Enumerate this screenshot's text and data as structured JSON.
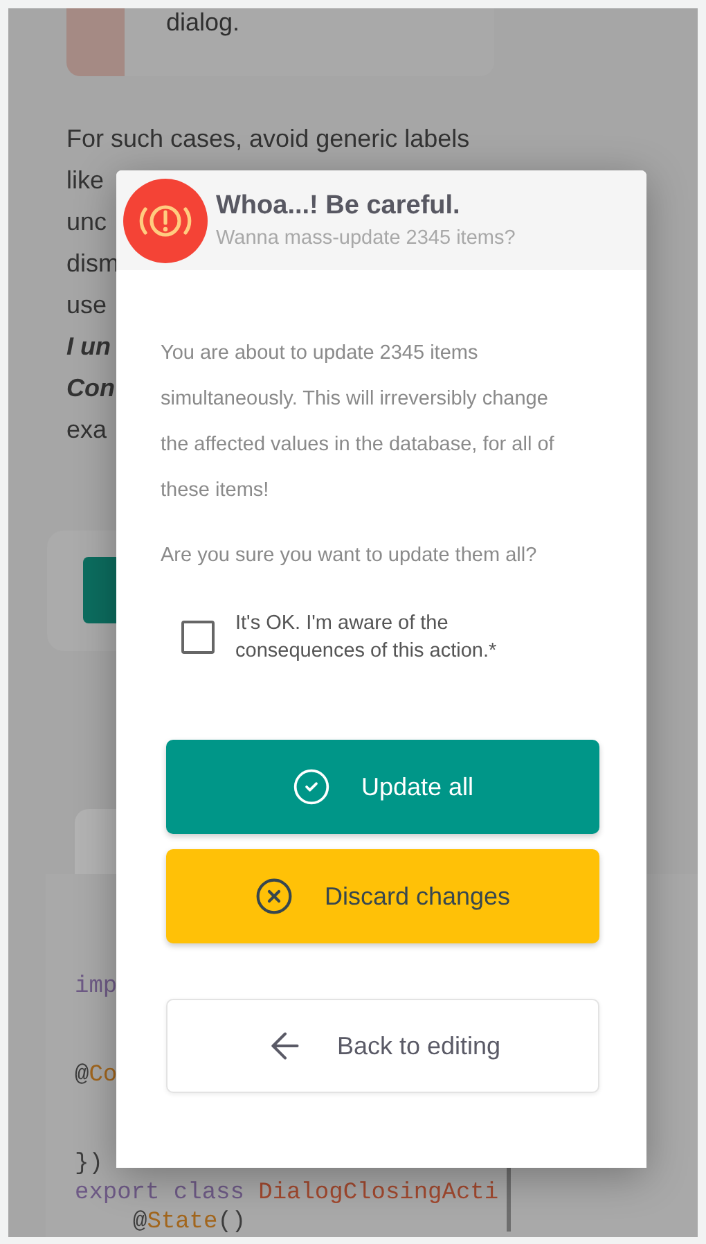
{
  "background": {
    "card_text": "dialog.",
    "paragraph": [
      {
        "text": "For such cases, avoid generic labels",
        "emphasis": false
      },
      {
        "text": "like",
        "emphasis": false
      },
      {
        "text": "unc",
        "emphasis": false
      },
      {
        "text": "dism",
        "emphasis": false
      },
      {
        "text": "use",
        "emphasis": false
      },
      {
        "text": "I un",
        "emphasis": true
      },
      {
        "text": "Con",
        "emphasis": true
      },
      {
        "text": "exa",
        "emphasis": false
      }
    ],
    "code": [
      {
        "gap": true,
        "tokens": [
          {
            "kind": "keyword",
            "text": "imp"
          }
        ]
      },
      {
        "gap": true,
        "tokens": [
          {
            "kind": "plain",
            "text": "@"
          },
          {
            "kind": "name",
            "text": "Co"
          }
        ]
      },
      {
        "gap": true,
        "tokens": [
          {
            "kind": "plain",
            "text": "})"
          }
        ]
      },
      {
        "gap": false,
        "tokens": [
          {
            "kind": "keyword",
            "text": "export class "
          },
          {
            "kind": "type",
            "text": "DialogClosingActi"
          }
        ]
      },
      {
        "gap": false,
        "indent": true,
        "tokens": [
          {
            "kind": "plain",
            "text": "@"
          },
          {
            "kind": "name",
            "text": "State"
          },
          {
            "kind": "plain",
            "text": "()"
          }
        ]
      }
    ]
  },
  "dialog": {
    "title": "Whoa...! Be careful.",
    "subtitle": "Wanna mass-update 2345 items?",
    "paragraphs": [
      "You are about to update 2345 items simultaneously. This will irreversibly change the affected values in the database, for all of these items!",
      "Are you sure you want to update them all?"
    ],
    "checkbox": {
      "label": "It's OK. I'm aware of the consequences of this action.*",
      "checked": false
    },
    "buttons": [
      {
        "label": "Update all",
        "kind": "confirm"
      },
      {
        "label": "Discard changes",
        "kind": "discard"
      },
      {
        "label": "Back to editing",
        "kind": "back"
      }
    ]
  }
}
